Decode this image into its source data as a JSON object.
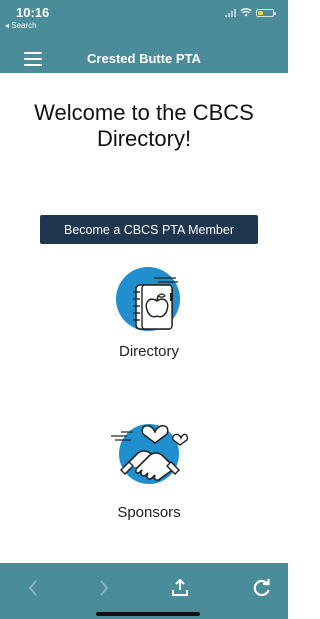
{
  "status_bar": {
    "time": "10:16",
    "back_label": "◂ Search"
  },
  "header": {
    "title": "Crested Butte PTA"
  },
  "main": {
    "welcome": "Welcome to the CBCS Directory!",
    "member_button": "Become a CBCS PTA Member",
    "tiles": [
      {
        "label": "Directory",
        "icon": "notebook-apple-icon"
      },
      {
        "label": "Sponsors",
        "icon": "handshake-heart-icon"
      }
    ]
  },
  "colors": {
    "bar": "#4a8c99",
    "button": "#1e3550",
    "icon_accent": "#1f8fcd",
    "battery": "#f7d23e"
  }
}
